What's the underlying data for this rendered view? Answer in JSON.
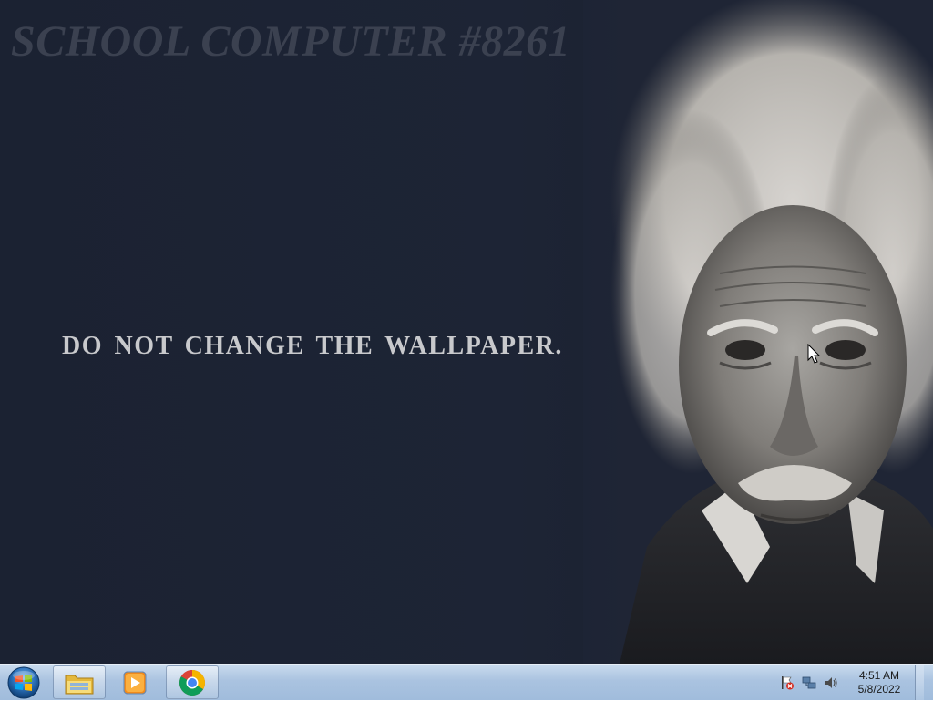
{
  "desktop": {
    "watermark_title": "SCHOOL COMPUTER #8261",
    "watermark_slogan": "DO NOT CHANGE THE WALLPAPER."
  },
  "taskbar": {
    "start_icon": "windows-start-orb-icon",
    "pinned": [
      {
        "icon": "file-explorer-folder-icon"
      },
      {
        "icon": "windows-media-player-icon"
      },
      {
        "icon": "google-chrome-icon"
      }
    ],
    "tray": {
      "icons": [
        "action-center-flag-icon",
        "network-icon",
        "volume-icon"
      ],
      "time": "4:51 AM",
      "date": "5/8/2022"
    }
  },
  "colors": {
    "desktop_bg": "#1c2232",
    "taskbar_bg": "#aac3e0",
    "watermark_title": "#3b4150",
    "slogan": "#c8c9cc"
  }
}
